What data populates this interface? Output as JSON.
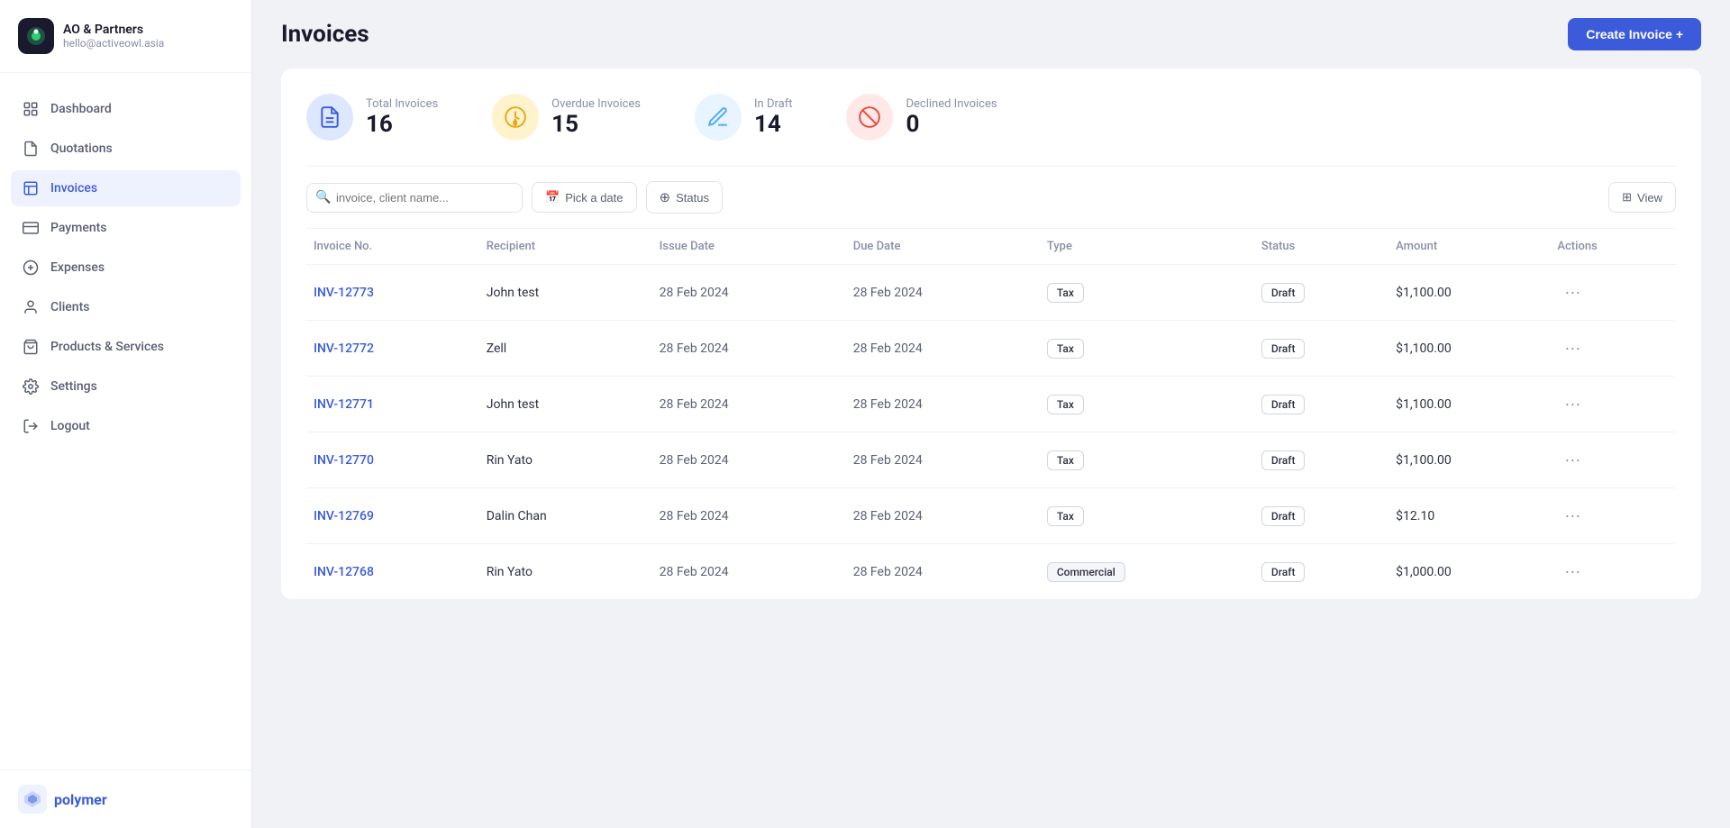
{
  "sidebar": {
    "company_name": "AO & Partners",
    "company_email": "hello@activeowl.asia",
    "nav_items": [
      {
        "id": "dashboard",
        "label": "Dashboard",
        "active": false
      },
      {
        "id": "quotations",
        "label": "Quotations",
        "active": false
      },
      {
        "id": "invoices",
        "label": "Invoices",
        "active": true
      },
      {
        "id": "payments",
        "label": "Payments",
        "active": false
      },
      {
        "id": "expenses",
        "label": "Expenses",
        "active": false
      },
      {
        "id": "clients",
        "label": "Clients",
        "active": false
      },
      {
        "id": "products-services",
        "label": "Products & Services",
        "active": false
      },
      {
        "id": "settings",
        "label": "Settings",
        "active": false
      },
      {
        "id": "logout",
        "label": "Logout",
        "active": false
      }
    ],
    "footer_brand": "polymer"
  },
  "header": {
    "title": "Invoices",
    "create_button": "Create Invoice  +"
  },
  "stats": [
    {
      "id": "total",
      "label": "Total Invoices",
      "value": "16",
      "icon_type": "document",
      "color_class": "blue"
    },
    {
      "id": "overdue",
      "label": "Overdue Invoices",
      "value": "15",
      "icon_type": "clock-dollar",
      "color_class": "yellow"
    },
    {
      "id": "draft",
      "label": "In Draft",
      "value": "14",
      "icon_type": "edit",
      "color_class": "light-blue"
    },
    {
      "id": "declined",
      "label": "Declined Invoices",
      "value": "0",
      "icon_type": "ban",
      "color_class": "red"
    }
  ],
  "toolbar": {
    "search_placeholder": "invoice, client name...",
    "date_filter": "Pick a date",
    "status_filter": "Status",
    "view_label": "View"
  },
  "table": {
    "columns": [
      "Invoice No.",
      "Recipient",
      "Issue Date",
      "Due Date",
      "Type",
      "Status",
      "Amount",
      "Actions"
    ],
    "rows": [
      {
        "invoice_no": "INV-12773",
        "recipient": "John test",
        "issue_date": "28 Feb 2024",
        "due_date": "28 Feb 2024",
        "type": "Tax",
        "status": "Draft",
        "amount": "$1,100.00"
      },
      {
        "invoice_no": "INV-12772",
        "recipient": "Zell",
        "issue_date": "28 Feb 2024",
        "due_date": "28 Feb 2024",
        "type": "Tax",
        "status": "Draft",
        "amount": "$1,100.00"
      },
      {
        "invoice_no": "INV-12771",
        "recipient": "John test",
        "issue_date": "28 Feb 2024",
        "due_date": "28 Feb 2024",
        "type": "Tax",
        "status": "Draft",
        "amount": "$1,100.00"
      },
      {
        "invoice_no": "INV-12770",
        "recipient": "Rin Yato",
        "issue_date": "28 Feb 2024",
        "due_date": "28 Feb 2024",
        "type": "Tax",
        "status": "Draft",
        "amount": "$1,100.00"
      },
      {
        "invoice_no": "INV-12769",
        "recipient": "Dalin Chan",
        "issue_date": "28 Feb 2024",
        "due_date": "28 Feb 2024",
        "type": "Tax",
        "status": "Draft",
        "amount": "$12.10"
      },
      {
        "invoice_no": "INV-12768",
        "recipient": "Rin Yato",
        "issue_date": "28 Feb 2024",
        "due_date": "28 Feb 2024",
        "type": "Commercial",
        "status": "Draft",
        "amount": "$1,000.00"
      }
    ]
  }
}
